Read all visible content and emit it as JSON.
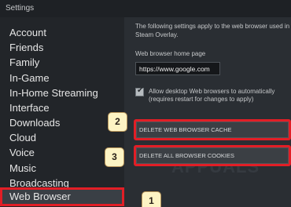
{
  "window": {
    "title": "Settings"
  },
  "sidebar": {
    "items": [
      {
        "label": "Account"
      },
      {
        "label": "Friends"
      },
      {
        "label": "Family"
      },
      {
        "label": "In-Game"
      },
      {
        "label": "In-Home Streaming"
      },
      {
        "label": "Interface"
      },
      {
        "label": "Downloads"
      },
      {
        "label": "Cloud"
      },
      {
        "label": "Voice"
      },
      {
        "label": "Music"
      },
      {
        "label": "Broadcasting"
      },
      {
        "label": "Web Browser",
        "selected": true
      }
    ]
  },
  "web_browser": {
    "description": "The following settings apply to the web browser used in Steam Overlay.",
    "home_page_label": "Web browser home page",
    "home_page_value": "https://www.google.com",
    "allow_desktop_browsers_label": "Allow desktop Web browsers to automatically (requires restart for changes to apply)",
    "allow_desktop_browsers_checked": true,
    "delete_cache_label": "DELETE WEB BROWSER CACHE",
    "delete_cookies_label": "DELETE ALL BROWSER COOKIES"
  },
  "annotations": {
    "step1": "1",
    "step2": "2",
    "step3": "3"
  },
  "colors": {
    "highlight": "#e21e26",
    "marker_bg": "#fdf4c4",
    "selected_bg": "#3a3f45"
  }
}
